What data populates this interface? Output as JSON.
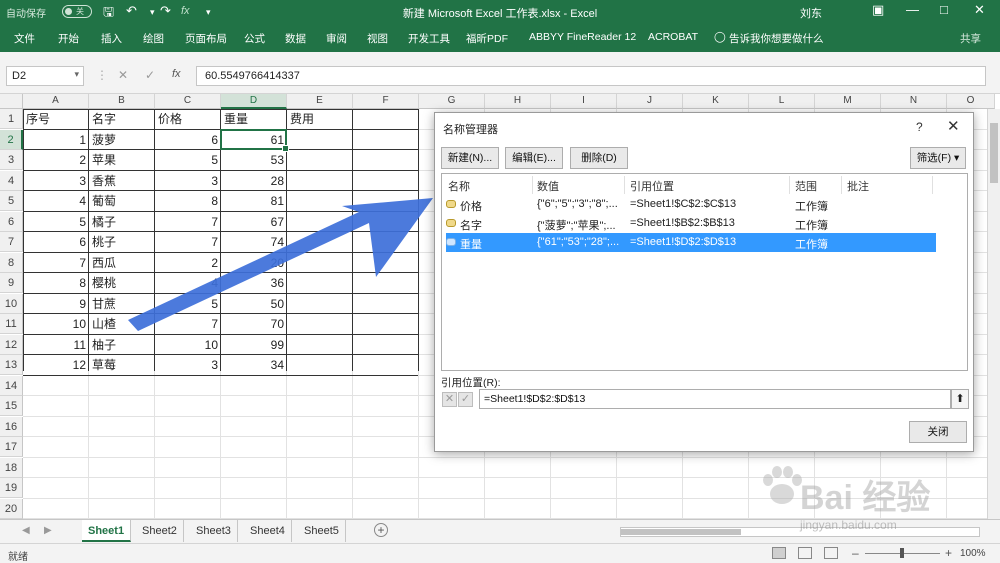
{
  "titlebar": {
    "autosave_label": "自动保存",
    "autosave_state": "关",
    "title": "新建 Microsoft Excel 工作表.xlsx  -  Excel",
    "user": "刘东",
    "qat": [
      "save-icon",
      "undo-icon",
      "redo-icon",
      "customize-icon"
    ]
  },
  "ribbon": {
    "tabs": [
      "文件",
      "开始",
      "插入",
      "绘图",
      "页面布局",
      "公式",
      "数据",
      "审阅",
      "视图",
      "开发工具",
      "福昕PDF",
      "ABBYY FineReader 12",
      "ACROBAT",
      "告诉我你想要做什么"
    ],
    "share": "共享"
  },
  "formula_bar": {
    "name_box": "D2",
    "fx": "fx",
    "value": "60.5549766414337"
  },
  "grid": {
    "columns": [
      "A",
      "B",
      "C",
      "D",
      "E",
      "F",
      "G",
      "H",
      "I",
      "J",
      "K",
      "L",
      "M",
      "N",
      "O"
    ],
    "rows": [
      "1",
      "2",
      "3",
      "4",
      "5",
      "6",
      "7",
      "8",
      "9",
      "10",
      "11",
      "12",
      "13",
      "14",
      "15",
      "16",
      "17",
      "18",
      "19",
      "20"
    ],
    "headers": [
      "序号",
      "名字",
      "价格",
      "重量",
      "费用"
    ],
    "data": [
      [
        "1",
        "菠萝",
        "6",
        "61"
      ],
      [
        "2",
        "苹果",
        "5",
        "53"
      ],
      [
        "3",
        "香蕉",
        "3",
        "28"
      ],
      [
        "4",
        "葡萄",
        "8",
        "81"
      ],
      [
        "5",
        "橘子",
        "7",
        "67"
      ],
      [
        "6",
        "桃子",
        "7",
        "74"
      ],
      [
        "7",
        "西瓜",
        "2",
        "20"
      ],
      [
        "8",
        "樱桃",
        "4",
        "36"
      ],
      [
        "9",
        "甘蔗",
        "5",
        "50"
      ],
      [
        "10",
        "山楂",
        "7",
        "70"
      ],
      [
        "11",
        "柚子",
        "10",
        "99"
      ],
      [
        "12",
        "草莓",
        "3",
        "34"
      ]
    ]
  },
  "sheets": {
    "tabs": [
      "Sheet1",
      "Sheet2",
      "Sheet3",
      "Sheet4",
      "Sheet5"
    ],
    "active": "Sheet1"
  },
  "status": {
    "ready": "就绪",
    "zoom": "100%"
  },
  "dialog": {
    "title": "名称管理器",
    "help": "?",
    "close": "✕",
    "buttons": {
      "new": "新建(N)...",
      "edit": "编辑(E)...",
      "delete": "删除(D)",
      "filter": "筛选(F) ▾"
    },
    "columns": [
      "名称",
      "数值",
      "引用位置",
      "范围",
      "批注"
    ],
    "names": [
      {
        "name": "价格",
        "value": "{\"6\";\"5\";\"3\";\"8\";...",
        "ref": "=Sheet1!$C$2:$C$13",
        "scope": "工作簿",
        "comment": ""
      },
      {
        "name": "名字",
        "value": "{\"菠萝\";\"苹果\";...",
        "ref": "=Sheet1!$B$2:$B$13",
        "scope": "工作簿",
        "comment": ""
      },
      {
        "name": "重量",
        "value": "{\"61\";\"53\";\"28\";...",
        "ref": "=Sheet1!$D$2:$D$13",
        "scope": "工作簿",
        "comment": ""
      }
    ],
    "ref_label": "引用位置(R):",
    "ref_value": "=Sheet1!$D$2:$D$13",
    "close_button": "关闭"
  },
  "watermark": {
    "brand": "Bai 经验",
    "url": "jingyan.baidu.com"
  },
  "colors": {
    "excel_green": "#217346",
    "arrow_blue": "#3d6fd9",
    "selection_blue": "#3399ff"
  }
}
